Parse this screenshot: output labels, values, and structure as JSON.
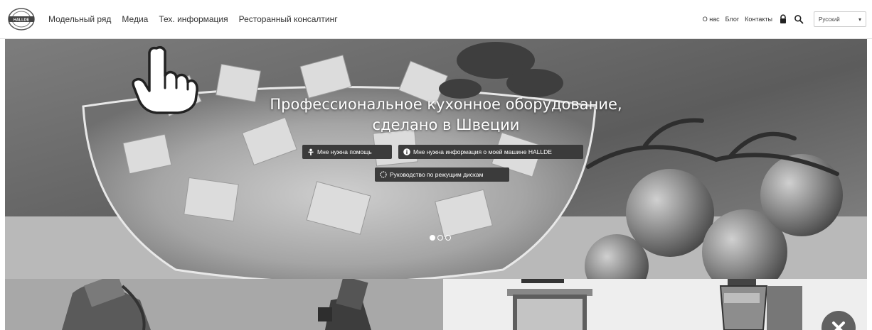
{
  "header": {
    "logo_text": "HALLDE",
    "nav": {
      "models": "Модельный ряд",
      "media": "Медиа",
      "tech_info": "Тех. информация",
      "consulting": "Ресторанный консалтинг"
    },
    "util": {
      "about": "О нас",
      "blog": "Блог",
      "contacts": "Контакты",
      "lock_icon": "lock-icon",
      "search_icon": "search-icon"
    },
    "language": {
      "selected": "Русский"
    }
  },
  "hero": {
    "title_line1": "Профессиональное кухонное оборудование,",
    "title_line2": "сделано в Швеции",
    "buttons": {
      "help": "Мне нужна помощь",
      "info": "Мне нужна информация о моей машине HALLDE",
      "guide": "Руководство по режущим дискам"
    },
    "icons": {
      "help": "help-person-icon",
      "info": "info-icon",
      "guide": "cutting-disc-icon"
    },
    "slides": {
      "count": 3,
      "active_index": 0
    }
  },
  "products": {
    "tiles": [
      "vegetable-cutter",
      "vegetable-cutter-large",
      "pot-machine",
      "blender"
    ]
  },
  "overlay": {
    "close_icon": "close-icon",
    "pointer_icon": "hand-pointer-icon"
  },
  "colors": {
    "button_bg": "#3b3b3b",
    "hero_text": "#ffffff",
    "nav_text": "#333333"
  }
}
